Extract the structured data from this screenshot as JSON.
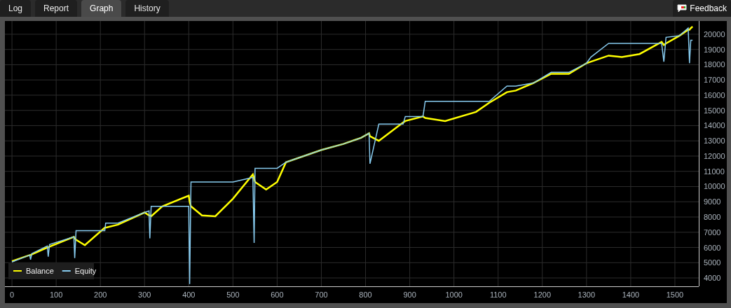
{
  "tabs": [
    {
      "label": "Log",
      "selected": false
    },
    {
      "label": "Report",
      "selected": false
    },
    {
      "label": "Graph",
      "selected": true
    },
    {
      "label": "History",
      "selected": false
    }
  ],
  "feedback_button": {
    "label": "Feedback"
  },
  "graph": {
    "chart_data": {
      "type": "line",
      "x": [
        0,
        40,
        42,
        45,
        80,
        82,
        85,
        140,
        142,
        145,
        165,
        210,
        212,
        240,
        300,
        310,
        312,
        315,
        340,
        400,
        402,
        405,
        430,
        460,
        500,
        545,
        548,
        550,
        575,
        600,
        620,
        700,
        750,
        790,
        808,
        810,
        830,
        885,
        890,
        930,
        935,
        980,
        1050,
        1080,
        1120,
        1140,
        1180,
        1220,
        1260,
        1300,
        1310,
        1350,
        1380,
        1420,
        1470,
        1475,
        1480,
        1510,
        1530,
        1533,
        1536,
        1540
      ],
      "series": [
        {
          "name": "Balance",
          "color": "#ffff00",
          "values": [
            5100,
            5500,
            5500,
            5550,
            6000,
            6000,
            6050,
            6700,
            6600,
            6500,
            6150,
            7300,
            7300,
            7500,
            8300,
            8100,
            8100,
            8050,
            8700,
            9400,
            9000,
            8700,
            8100,
            8050,
            9200,
            10800,
            10500,
            10300,
            9800,
            10300,
            11600,
            12400,
            12800,
            13200,
            13500,
            13300,
            13000,
            14200,
            14300,
            14600,
            14500,
            14300,
            14900,
            15500,
            16200,
            16300,
            16800,
            17400,
            17400,
            18100,
            18200,
            18600,
            18500,
            18700,
            19500,
            19300,
            19400,
            19900,
            20300,
            20300,
            20400,
            20500
          ]
        },
        {
          "name": "Equity",
          "color": "#87cbef",
          "values": [
            5050,
            5500,
            5200,
            5600,
            6100,
            5400,
            6200,
            6700,
            5300,
            7100,
            7100,
            7100,
            7600,
            7600,
            8300,
            8400,
            6600,
            8700,
            8700,
            8700,
            3600,
            10300,
            10300,
            10300,
            10300,
            10600,
            6300,
            11200,
            11200,
            11200,
            11600,
            12400,
            12800,
            13200,
            13500,
            11500,
            14100,
            14100,
            14600,
            14600,
            15600,
            15600,
            15600,
            15600,
            16600,
            16600,
            16800,
            17500,
            17500,
            18100,
            18500,
            19400,
            19400,
            19400,
            19400,
            18200,
            19800,
            19900,
            20400,
            18100,
            19600,
            19600
          ]
        }
      ],
      "grid": true,
      "legend": true,
      "xlim": [
        -16,
        1554
      ],
      "ylim": [
        3450,
        20870
      ],
      "xticks": [
        0,
        100,
        200,
        300,
        400,
        500,
        600,
        700,
        800,
        900,
        1000,
        1100,
        1200,
        1300,
        1400,
        1500
      ],
      "yticks": [
        4000,
        5000,
        6000,
        7000,
        8000,
        9000,
        10000,
        11000,
        12000,
        13000,
        14000,
        15000,
        16000,
        17000,
        18000,
        19000,
        20000
      ]
    }
  }
}
